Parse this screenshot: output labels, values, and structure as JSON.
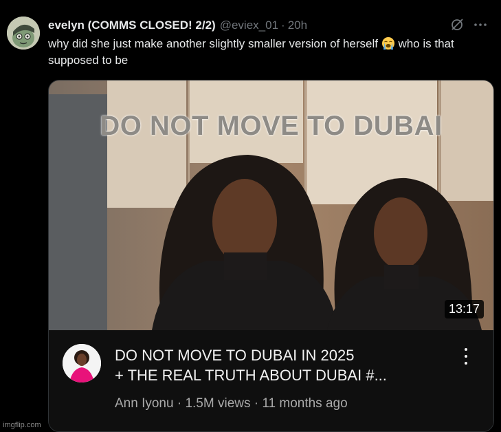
{
  "tweet": {
    "display_name": "evelyn (COMMS CLOSED! 2/2)",
    "handle": "@eviex_01",
    "dot": "·",
    "time": "20h",
    "text_before_emoji": "why did she just make another slightly smaller version of herself ",
    "emoji_name": "loudly-crying-face-emoji",
    "text_after_emoji": " who is that supposed to be",
    "icons": [
      "grok-icon",
      "more-icon"
    ]
  },
  "video": {
    "thumbnail_text": "DO NOT MOVE TO DUBAI",
    "duration": "13:17",
    "title_line1": "DO NOT MOVE TO DUBAI IN 2025",
    "title_line2": "+ THE REAL TRUTH ABOUT DUBAI #...",
    "meta": "Ann Iyonu · 1.5M views · 11 months ago"
  },
  "watermark": "imgflip.com",
  "colors": {
    "background": "#000000",
    "text_primary": "#e7e9ea",
    "text_secondary": "#71767b",
    "card_bg": "#0f0f0f",
    "meta_text": "#aaaaaa"
  }
}
